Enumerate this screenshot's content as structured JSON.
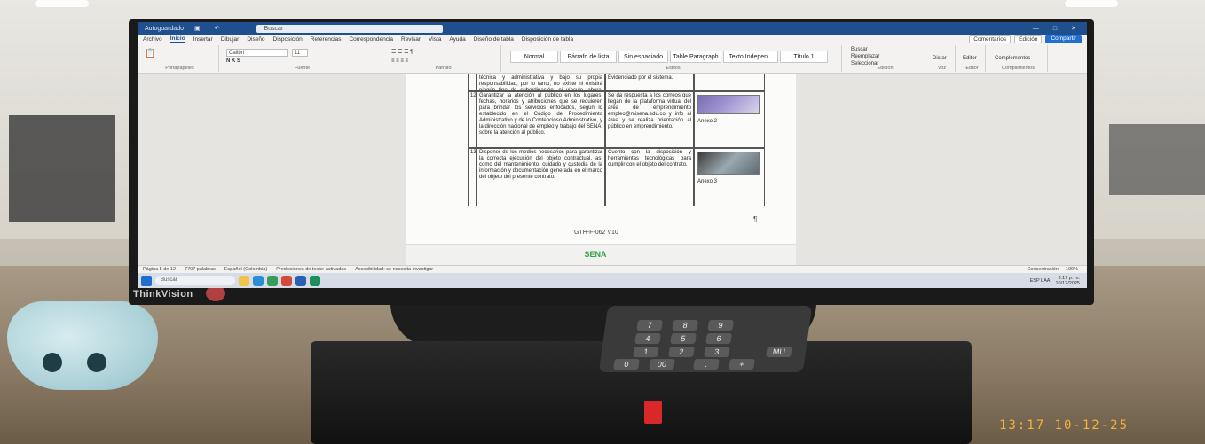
{
  "word": {
    "title_fragment": "Autoguardado",
    "search_placeholder": "Buscar",
    "menu": [
      "Archivo",
      "Inicio",
      "Insertar",
      "Dibujar",
      "Diseño",
      "Disposición",
      "Referencias",
      "Correspondencia",
      "Revisar",
      "Vista",
      "Ayuda",
      "Diseño de tabla",
      "Disposición de tabla"
    ],
    "menu_active_index": 1,
    "comments_label": "Comentarios",
    "edit_label": "Edición",
    "share_label": "Compartir",
    "font_name": "Calibri",
    "font_size": "11",
    "styles": [
      "Normal",
      "Párrafo de lista",
      "Sin espaciado",
      "Table Paragraph",
      "Texto Indepen...",
      "Título 1"
    ],
    "ribbon_groups": [
      "Portapapeles",
      "Fuente",
      "Párrafo",
      "Estilos",
      "Edición",
      "Voz",
      "Editor",
      "Complementos"
    ],
    "ribbon_right": [
      "Buscar",
      "Reemplazar",
      "Seleccionar"
    ],
    "dictate_label": "Dictar",
    "editor_label": "Editor",
    "addins_label": "Complementos",
    "table_row_12_num": "12",
    "table_row_13_num": "13",
    "row12_text": "Garantizar la atención al público en los lugares, fechas, horarios y atribuciones que se requieren para brindar los servicios enfocados, según lo establecido en el Código de Procedimiento Administrativo y de lo Contencioso Administrativo, y la dirección nacional de empleo y trabajo del SENA, sobre la atención al público.",
    "row12_result": "Se da respuesta a los correos que llegan de la plataforma virtual del área de emprendimiento empleo@misena.edu.co y info al área y se realiza orientación al público en emprendimiento.",
    "row13_text": "Disponer de los medios necesarios para garantizar la correcta ejecución del objeto contractual, así como del mantenimiento, cuidado y custodia de la información y documentación generada en el marco del objeto del presente contrato.",
    "row13_result": "Cuento con la disposición y herramientas tecnológicas para cumplir con el objeto del contrato.",
    "top_text": "técnica y administrativa y bajo su propia responsabilidad, por lo tanto, no existe ni existirá ningún tipo de subordinación, ni vínculo laboral alguno entre EL CONTRATISTA y el SENA.",
    "top_result": "Evidenciado por el sistema.",
    "evidence_label_1": "Anexo 2",
    "evidence_label_2": "Anexo 3",
    "doc_code": "GTH-F-062 V10",
    "footer_logo": "SENA",
    "status_page": "Página 5 de 12",
    "status_words": "7707 palabras",
    "status_lang": "Español (Colombia)",
    "status_predict": "Predicciones de texto: activadas",
    "status_access": "Accesibilidad: se necesita investigar",
    "status_focus": "Concentración",
    "status_zoom": "100%"
  },
  "taskbar": {
    "search": "Buscar",
    "time": "3:17 p. m.",
    "date": "10/12/2025",
    "lang": "ESP LAA"
  },
  "monitor_brand": "ThinkVision",
  "calculator_keys": [
    "7",
    "8",
    "9",
    "4",
    "5",
    "6",
    "1",
    "2",
    "3",
    "0",
    "00",
    ".",
    "+",
    "MU"
  ],
  "photo_timestamp": "13:17 10-12-25",
  "colors": {
    "title_bar": "#1f4f8f",
    "share": "#1f6fd1",
    "timestamp": "#f4b23a",
    "sena_green": "#3aa14a"
  }
}
